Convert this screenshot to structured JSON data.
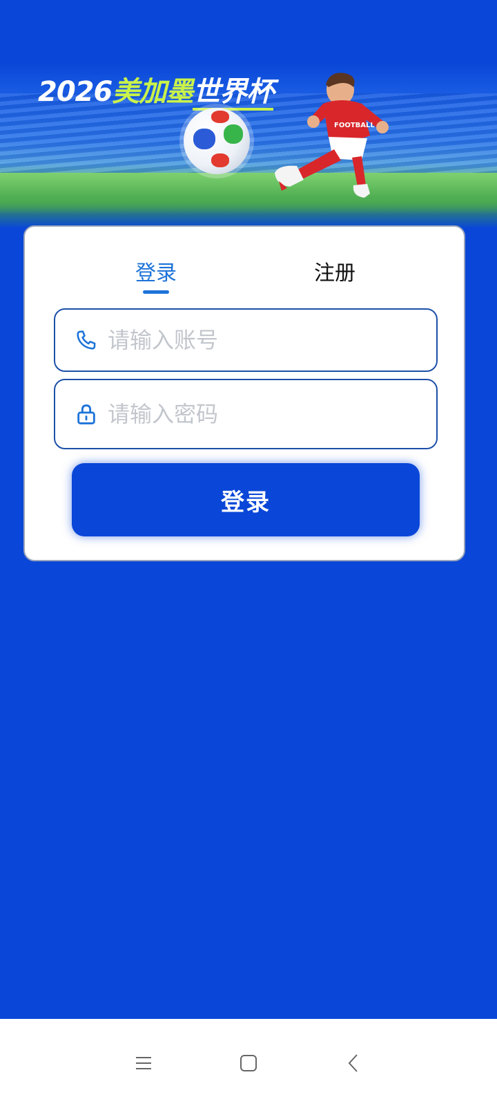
{
  "banner": {
    "year": "2026",
    "title_highlight": "美加墨",
    "title_rest": "世界杯",
    "jersey_text": "FOOTBALL"
  },
  "tabs": {
    "login": "登录",
    "register": "注册"
  },
  "form": {
    "account_placeholder": "请输入账号",
    "password_placeholder": "请输入密码",
    "submit_label": "登录"
  },
  "icons": {
    "account": "phone-icon",
    "password": "lock-icon",
    "nav_menu": "menu-icon",
    "nav_home": "home-icon",
    "nav_back": "back-icon"
  },
  "colors": {
    "background": "#0a47d8",
    "accent": "#1d73d8",
    "title_highlight": "#c9f24a"
  }
}
